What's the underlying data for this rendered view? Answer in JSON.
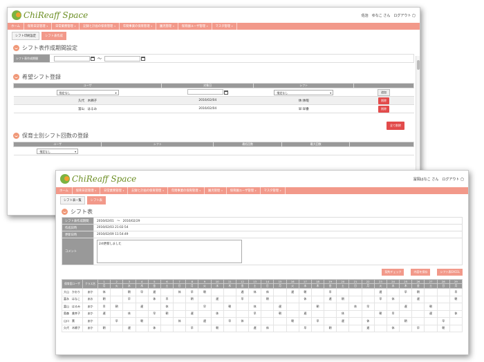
{
  "logo_text": "ChiReaff Space",
  "win1": {
    "user_name": "佐治　ゆなこ さん",
    "logout": "ログアウト",
    "nav": [
      "ホーム",
      "保育日誌管理",
      "日常業務管理",
      "記録と計画の保育管理",
      "年間事業の保育管理",
      "園児管理",
      "保育園ユーザ管理",
      "マスタ管理"
    ],
    "tabs": [
      "シフト印刷設定",
      "シフト表作成"
    ],
    "section1_title": "シフト表作成期間設定",
    "period_label": "シフト表作成期間",
    "tilde": "〜",
    "section2_title": "希望シフト登録",
    "request_headers": [
      "ユーザ",
      "対象日",
      "シフト",
      ""
    ],
    "filter_user": "指定なし",
    "filter_shift": "指定なし",
    "add_button": "追加",
    "requests": [
      {
        "user": "久代　木綿子",
        "date": "2016/02/04",
        "shift": "休:休暇",
        "action": "削除"
      },
      {
        "user": "冨山　はるみ",
        "date": "2016/02/04",
        "shift": "早:早番",
        "action": "削除"
      }
    ],
    "delete_all": "全て削除",
    "section3_title": "保育士別シフト回数の登録",
    "count_headers": [
      "ユーザ",
      "シフト",
      "最低回数",
      "最大回数",
      ""
    ],
    "count_filter": "指定なし"
  },
  "win2": {
    "user_name": "冨岡はなこ さん",
    "logout": "ログアウト",
    "nav": [
      "ホーム",
      "保育日誌管理",
      "日常業務管理",
      "記録と計画の保育管理",
      "年間事業の保育管理",
      "園児管理",
      "保育園ユーザ管理",
      "マスタ管理"
    ],
    "tabs": [
      "シフト表一覧",
      "シフト表"
    ],
    "section_title": "シフト表",
    "info": [
      {
        "label": "シフト表作成期間",
        "value": "2016/02/01　〜　2016/02/29"
      },
      {
        "label": "作成日時",
        "value": "2016/02/03 21:02:54"
      },
      {
        "label": "更新日時",
        "value": "2016/02/09 11:54:49"
      }
    ],
    "comment_label": "コメント",
    "comment_value": "2/4更新しました",
    "buttons": [
      "契約チェック",
      "内容を保存",
      "シフト表EXCEL"
    ],
    "shift_header_user": "保育園ユーザ",
    "shift_header_class": "クラス名",
    "days": [
      "1",
      "2",
      "3",
      "4",
      "5",
      "6",
      "7",
      "8",
      "9",
      "10",
      "11",
      "12",
      "13",
      "14",
      "15",
      "16",
      "17",
      "18",
      "19",
      "20",
      "21",
      "22",
      "23",
      "24",
      "25",
      "26",
      "27",
      "28",
      "29"
    ],
    "weekdays": [
      "月",
      "火",
      "水",
      "木",
      "金",
      "土",
      "日",
      "月",
      "火",
      "水",
      "木",
      "金",
      "土",
      "日",
      "月",
      "火",
      "水",
      "木",
      "金",
      "土",
      "日",
      "月",
      "火",
      "水",
      "木",
      "金",
      "土",
      "日",
      "月"
    ],
    "rows": [
      {
        "name": "大山　かおり",
        "class": "あか",
        "shifts": [
          "休",
          "",
          "朝",
          "早",
          "遅",
          "",
          "休",
          "早",
          "朝",
          "",
          "",
          "遅",
          "休",
          "休",
          "",
          "遅",
          "朝",
          "",
          "早",
          "",
          "",
          "",
          "遅",
          "",
          "早",
          "朝",
          "",
          "",
          "早"
        ]
      },
      {
        "name": "冨永　はなこ",
        "class": "あお",
        "shifts": [
          "朝",
          "",
          "早",
          "",
          "休",
          "早",
          "",
          "朝",
          "",
          "遅",
          "",
          "早",
          "",
          "朝",
          "",
          "",
          "休",
          "",
          "遅",
          "朝",
          "",
          "",
          "早",
          "休",
          "",
          "遅",
          "",
          "",
          "朝"
        ]
      },
      {
        "name": "冨山　はるみ",
        "class": "あか",
        "shifts": [
          "早",
          "朝",
          "",
          "遅",
          "",
          "休",
          "",
          "",
          "早",
          "",
          "朝",
          "",
          "休",
          "",
          "遅",
          "",
          "",
          "朝",
          "",
          "",
          "休",
          "早",
          "",
          "",
          "遅",
          "",
          "朝",
          "",
          ""
        ]
      },
      {
        "name": "奥森　美幸子",
        "class": "あか",
        "shifts": [
          "遅",
          "",
          "休",
          "",
          "早",
          "朝",
          "",
          "遅",
          "",
          "休",
          "",
          "",
          "早",
          "",
          "朝",
          "",
          "遅",
          "",
          "",
          "休",
          "",
          "",
          "朝",
          "早",
          "",
          "",
          "遅",
          "",
          "休"
        ]
      },
      {
        "name": "山口　薫",
        "class": "あか",
        "shifts": [
          "",
          "早",
          "",
          "朝",
          "",
          "",
          "休",
          "",
          "遅",
          "",
          "早",
          "休",
          "",
          "",
          "",
          "朝",
          "",
          "早",
          "",
          "遅",
          "",
          "休",
          "",
          "",
          "朝",
          "",
          "",
          "早",
          ""
        ]
      },
      {
        "name": "久代　木綿子",
        "class": "あか",
        "shifts": [
          "朝",
          "",
          "遅",
          "",
          "休",
          "",
          "",
          "早",
          "",
          "朝",
          "",
          "",
          "遅",
          "休",
          "",
          "",
          "早",
          "",
          "朝",
          "",
          "",
          "遅",
          "",
          "休",
          "",
          "早",
          "",
          "朝",
          ""
        ]
      }
    ]
  }
}
